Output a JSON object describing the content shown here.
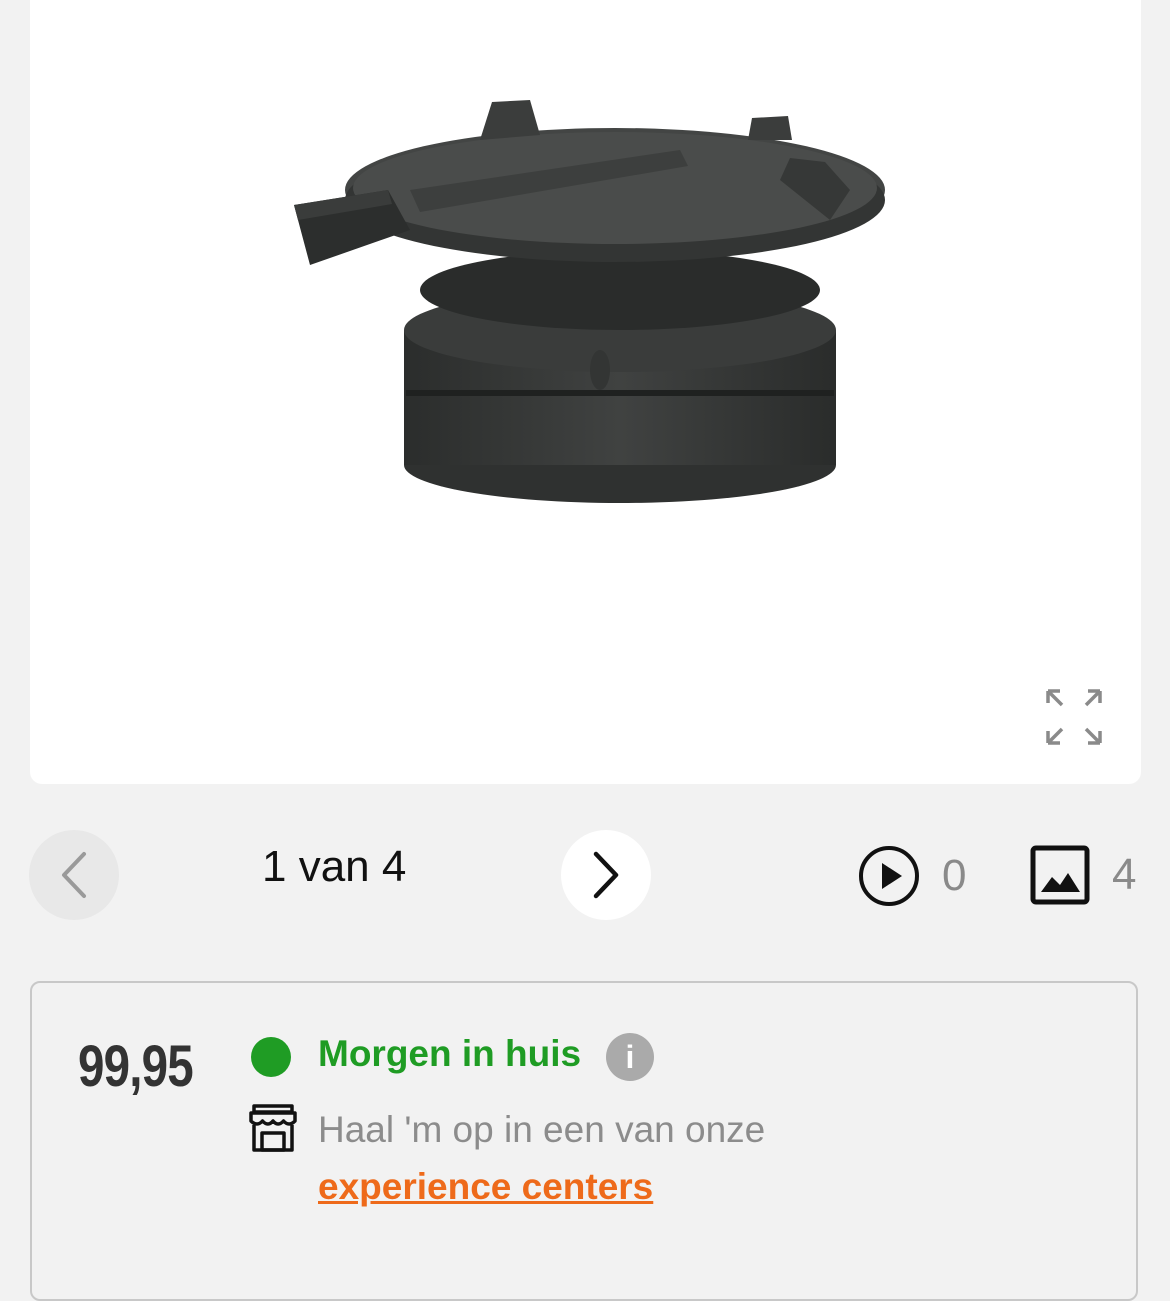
{
  "gallery": {
    "page_indicator": "1 van 4",
    "video_count": "0",
    "photo_count": "4"
  },
  "product": {
    "price": "99,95",
    "delivery_status": "Morgen in huis",
    "info_icon_glyph": "i",
    "pickup_text": "Haal 'm op in een van onze",
    "pickup_link": "experience centers"
  },
  "colors": {
    "green": "#1f9c24",
    "orange": "#ee6a1a",
    "grey_text": "#8c8c8c"
  },
  "icons": [
    "chevron-left-icon",
    "chevron-right-icon",
    "expand-icon",
    "play-icon",
    "image-icon",
    "store-icon",
    "info-icon"
  ]
}
